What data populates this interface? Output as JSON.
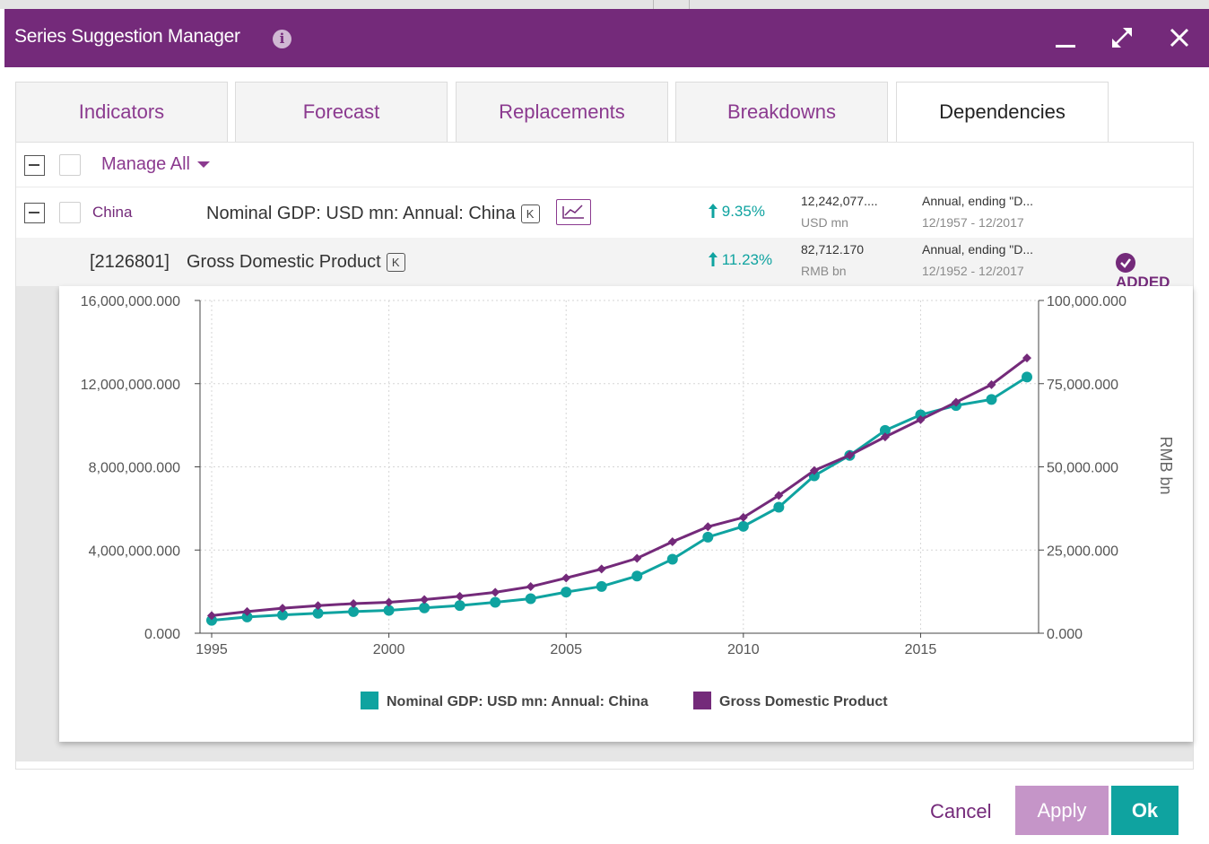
{
  "dialog": {
    "title": "Series Suggestion Manager",
    "info_icon": "info-icon",
    "controls": [
      "minimize-icon",
      "expand-icon",
      "close-icon"
    ]
  },
  "tabs": [
    {
      "label": "Indicators",
      "active": false
    },
    {
      "label": "Forecast",
      "active": false
    },
    {
      "label": "Replacements",
      "active": false
    },
    {
      "label": "Breakdowns",
      "active": false
    },
    {
      "label": "Dependencies",
      "active": true
    }
  ],
  "toolbar": {
    "manage_all": "Manage All"
  },
  "rows": [
    {
      "country": "China",
      "name": "Nominal GDP: USD mn: Annual: China",
      "k": "K",
      "change": "9.35%",
      "value": "12,242,077....",
      "unit": "USD mn",
      "frequency": "Annual, ending \"D...",
      "range": "12/1957 - 12/2017"
    },
    {
      "id": "[2126801]",
      "name": "Gross Domestic Product",
      "k": "K",
      "change": "11.23%",
      "value": "82,712.170",
      "unit": "RMB bn",
      "frequency": "Annual, ending \"D...",
      "range": "12/1952 - 12/2017",
      "status": "ADDED"
    }
  ],
  "colors": {
    "brand": "#742a7a",
    "accent": "#8b3a8f",
    "teal": "#0fa3a0",
    "apply_disabled": "#c595c8"
  },
  "chart_data": {
    "type": "line",
    "x": [
      1995,
      1996,
      1997,
      1998,
      1999,
      2000,
      2001,
      2002,
      2003,
      2004,
      2005,
      2006,
      2007,
      2008,
      2009,
      2010,
      2011,
      2012,
      2013,
      2014,
      2015,
      2016,
      2017,
      2018
    ],
    "xticks": [
      "1995",
      "2000",
      "2005",
      "2010",
      "2015"
    ],
    "left_axis": {
      "ylim": [
        0,
        16000000
      ],
      "ticks": [
        "16,000,000.000",
        "12,000,000.000",
        "8,000,000.000",
        "4,000,000.000",
        "0.000"
      ]
    },
    "right_axis": {
      "label": "RMB bn",
      "ylim": [
        0,
        100000
      ],
      "ticks": [
        "100,000.000",
        "75,000.000",
        "50,000.000",
        "25,000.000",
        "0.000"
      ]
    },
    "grid": true,
    "legend": "bottom",
    "series": [
      {
        "name": "Nominal GDP: USD mn: Annual: China",
        "axis": "left",
        "color": "#0fa3a0",
        "marker": "circle",
        "values": [
          620000,
          780000,
          880000,
          960000,
          1040000,
          1100000,
          1220000,
          1330000,
          1490000,
          1660000,
          1980000,
          2250000,
          2750000,
          3560000,
          4620000,
          5140000,
          6060000,
          7570000,
          8550000,
          9750000,
          10500000,
          10950000,
          11240000,
          12320000
        ]
      },
      {
        "name": "Gross Domestic Product",
        "axis": "right",
        "color": "#742a7a",
        "marker": "diamond",
        "values": [
          5300,
          6500,
          7500,
          8300,
          8900,
          9300,
          10100,
          11100,
          12300,
          14000,
          16600,
          19300,
          22500,
          27500,
          32000,
          34800,
          41400,
          48900,
          53500,
          59000,
          64200,
          69400,
          74700,
          82700
        ]
      }
    ]
  },
  "footer": {
    "cancel": "Cancel",
    "apply": "Apply",
    "ok": "Ok"
  }
}
